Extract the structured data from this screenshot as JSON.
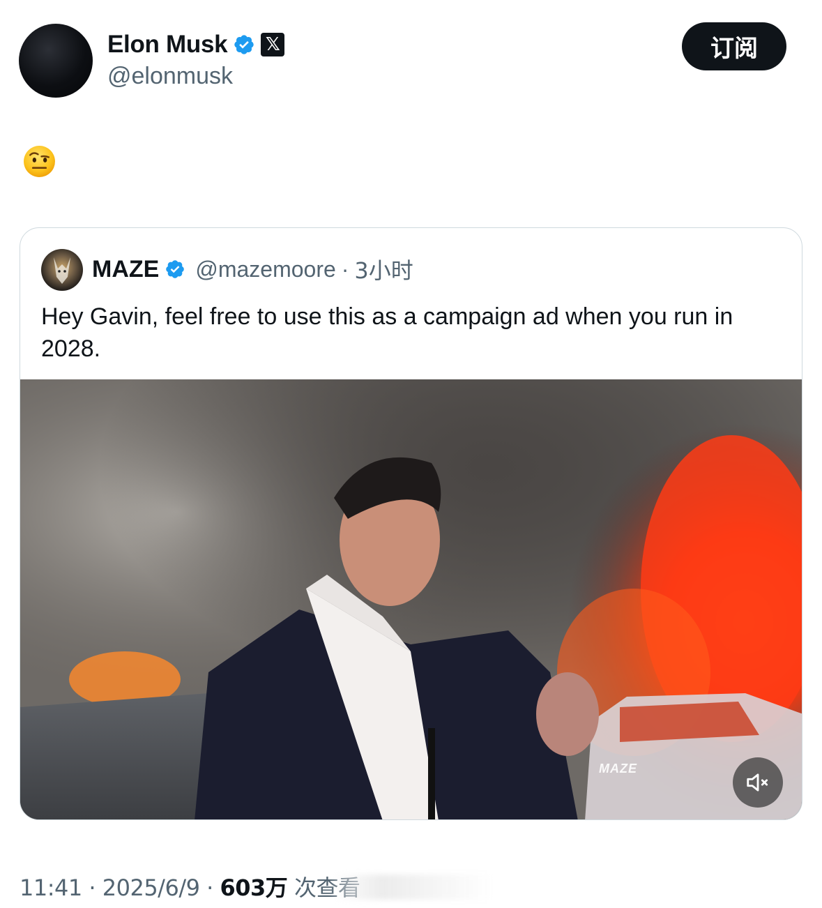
{
  "author": {
    "name": "Elon Musk",
    "handle": "@elonmusk",
    "verified": true,
    "affiliate_badge": "𝕏"
  },
  "subscribe_label": "订阅",
  "post_body_emoji": "raised-eyebrow-face",
  "quoted": {
    "name": "MAZE",
    "handle": "@mazemoore",
    "separator": "·",
    "time": "3小时",
    "verified": true,
    "text": "Hey Gavin, feel free to use this as a campaign ad when you run in 2028.",
    "media": {
      "kind": "video",
      "watermark": "MAZE",
      "muted": true
    }
  },
  "footer": {
    "time": "11:41",
    "sep1": " · ",
    "date": "2025/6/9",
    "sep2": " · ",
    "views": "603万",
    "views_suffix": " 次查看"
  },
  "colors": {
    "text": "#0f1419",
    "secondary": "#536471",
    "verified_blue": "#1d9bf0",
    "border": "#cfd9de"
  }
}
